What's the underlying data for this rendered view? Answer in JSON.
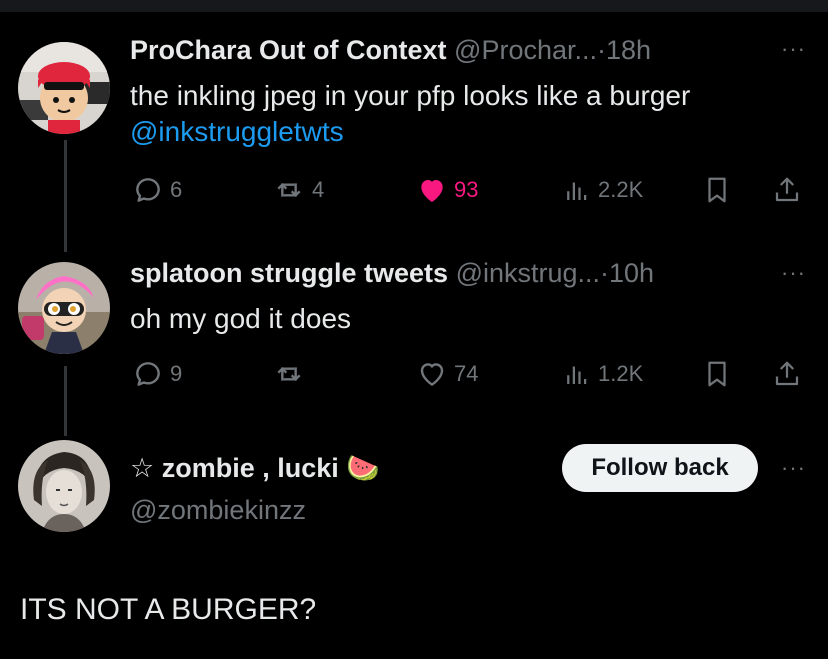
{
  "tweets": [
    {
      "display_name": "ProChara Out of Context",
      "handle": "@Prochar...",
      "separator": "·",
      "time": "18h",
      "text": "the inkling jpeg in your pfp looks like a burger",
      "mention": "@inkstruggletwts",
      "replies": "6",
      "retweets": "4",
      "likes": "93",
      "views": "2.2K",
      "liked": true
    },
    {
      "display_name": "splatoon struggle tweets",
      "handle": "@inkstrug...",
      "separator": "·",
      "time": "10h",
      "text": "oh my god it does",
      "replies": "9",
      "retweets": "",
      "likes": "74",
      "views": "1.2K",
      "liked": false
    }
  ],
  "profile": {
    "display_name": "☆ zombie , lucki 🍉",
    "handle": "@zombiekinzz",
    "follow_label": "Follow back"
  },
  "draft_text": "ITS NOT A BURGER?",
  "more_label": "···",
  "colors": {
    "background": "#000000",
    "text": "#e7e9ea",
    "muted": "#71767b",
    "link": "#1d9bf0",
    "like": "#f91880",
    "thread_line": "#333639"
  }
}
